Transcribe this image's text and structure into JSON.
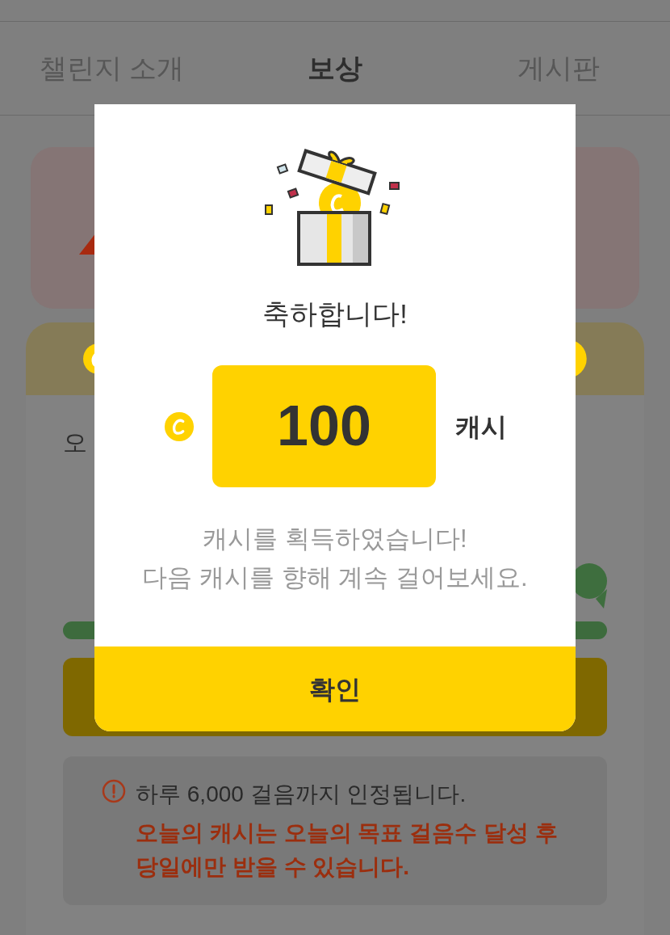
{
  "tabs": [
    {
      "label": "챌린지 소개",
      "selected": false
    },
    {
      "label": "보상",
      "selected": true
    },
    {
      "label": "게시판",
      "selected": false
    }
  ],
  "reward_card": {
    "title_partial": "오"
  },
  "notice": {
    "line": "하루 6,000 걸음까지 인정됩니다.",
    "warning": "오늘의 캐시는 오늘의 목표 걸음수 달성 후 당일에만 받을 수 있습니다."
  },
  "dialog": {
    "title": "축하합니다!",
    "amount": "100",
    "unit": "캐시",
    "message": "캐시를 획득하였습니다!\n다음 캐시를 향해 계속 걸어보세요.",
    "confirm": "확인"
  }
}
